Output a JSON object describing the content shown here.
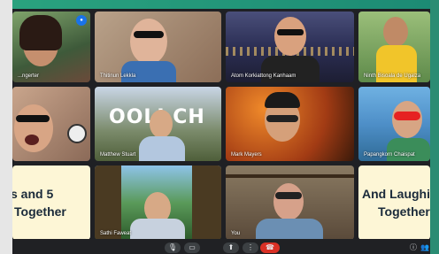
{
  "participants": [
    {
      "name": "...ngerter"
    },
    {
      "name": "Thitinun Lekkla"
    },
    {
      "name": "Atom Korkiattong Kanhaam"
    },
    {
      "name": "Ninth Bisoala de Ugalza"
    },
    {
      "name": ""
    },
    {
      "name": "Matthew Stuart"
    },
    {
      "name": "Mark Mayers"
    },
    {
      "name": "Papangkorn Chaispat"
    },
    {
      "name": "Sathi Faweat"
    },
    {
      "name": "You"
    }
  ],
  "slide_left": {
    "line1": "s and 5",
    "line2": "Together"
  },
  "slide_right": {
    "line1": "And Laughi",
    "line2": "Together"
  },
  "hollywood_sign": "OOLI CH",
  "controls": {
    "mic": "🎙",
    "camera": "▭",
    "present": "⬆",
    "more": "⋮",
    "leave": "☎",
    "info": "ⓘ",
    "people": "👥"
  }
}
